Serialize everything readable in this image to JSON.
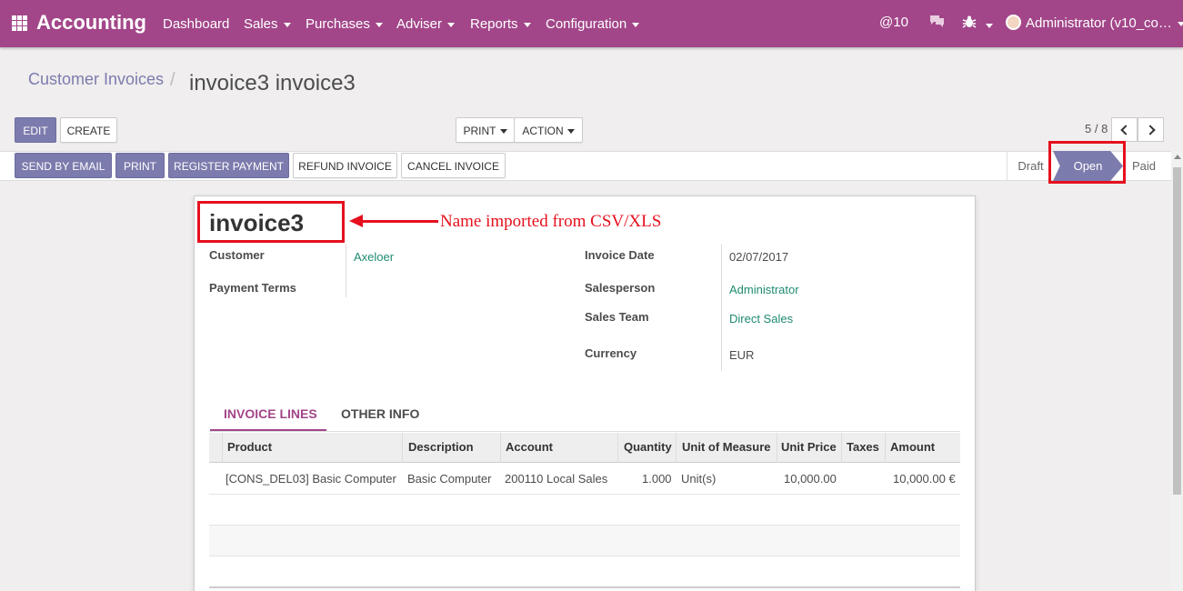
{
  "nav": {
    "app_title": "Accounting",
    "menu": [
      "Dashboard",
      "Sales",
      "Purchases",
      "Adviser",
      "Reports",
      "Configuration"
    ],
    "mentions": "@10",
    "user": "Administrator (v10_co…",
    "brand_color": "#a24689",
    "icons": [
      "app-switcher-icon",
      "chat-icon",
      "bug-icon"
    ]
  },
  "breadcrumb": {
    "parent": "Customer Invoices",
    "current": "invoice3 invoice3"
  },
  "control": {
    "edit": "EDIT",
    "create": "CREATE",
    "print": "PRINT",
    "action": "ACTION",
    "pager": "5 / 8"
  },
  "header_buttons": {
    "send_email": "SEND BY EMAIL",
    "print": "PRINT",
    "register_payment": "REGISTER PAYMENT",
    "refund": "REFUND INVOICE",
    "cancel": "CANCEL INVOICE"
  },
  "status": {
    "stages": [
      "Draft",
      "Open",
      "Paid"
    ],
    "current": "Open",
    "accent": "#7c7bad"
  },
  "annotation": {
    "text": "Name imported from CSV/XLS",
    "color": "#e5101e"
  },
  "invoice": {
    "name": "invoice3",
    "customer_label": "Customer",
    "customer": "Axeloer",
    "payment_terms_label": "Payment Terms",
    "invoice_date_label": "Invoice Date",
    "invoice_date": "02/07/2017",
    "salesperson_label": "Salesperson",
    "salesperson": "Administrator",
    "sales_team_label": "Sales Team",
    "sales_team": "Direct Sales",
    "currency_label": "Currency",
    "currency": "EUR"
  },
  "tabs": [
    "INVOICE LINES",
    "OTHER INFO"
  ],
  "table": {
    "headers": [
      "Product",
      "Description",
      "Account",
      "Quantity",
      "Unit of Measure",
      "Unit Price",
      "Taxes",
      "Amount"
    ],
    "rows": [
      [
        "[CONS_DEL03] Basic Computer",
        "Basic Computer",
        "200110 Local Sales",
        "1.000",
        "Unit(s)",
        "10,000.00",
        "",
        "10,000.00 €"
      ]
    ]
  }
}
